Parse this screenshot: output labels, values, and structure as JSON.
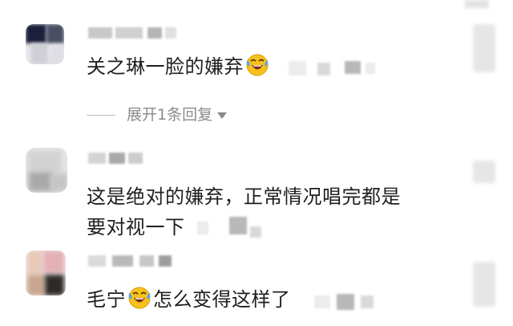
{
  "comments": [
    {
      "text": "关之琳一脸的嫌弃",
      "has_emoji": true,
      "emoji_icon": "laughing-crying-emoji"
    },
    {
      "text_line1": "这是绝对的嫌弃，正常情况唱完都是",
      "text_line2": "要对视一下"
    },
    {
      "text_before": "毛宁",
      "text_after": "怎么变得这样了",
      "emoji_icon": "laughing-crying-emoji"
    }
  ],
  "expand_replies_label": "展开1条回复"
}
